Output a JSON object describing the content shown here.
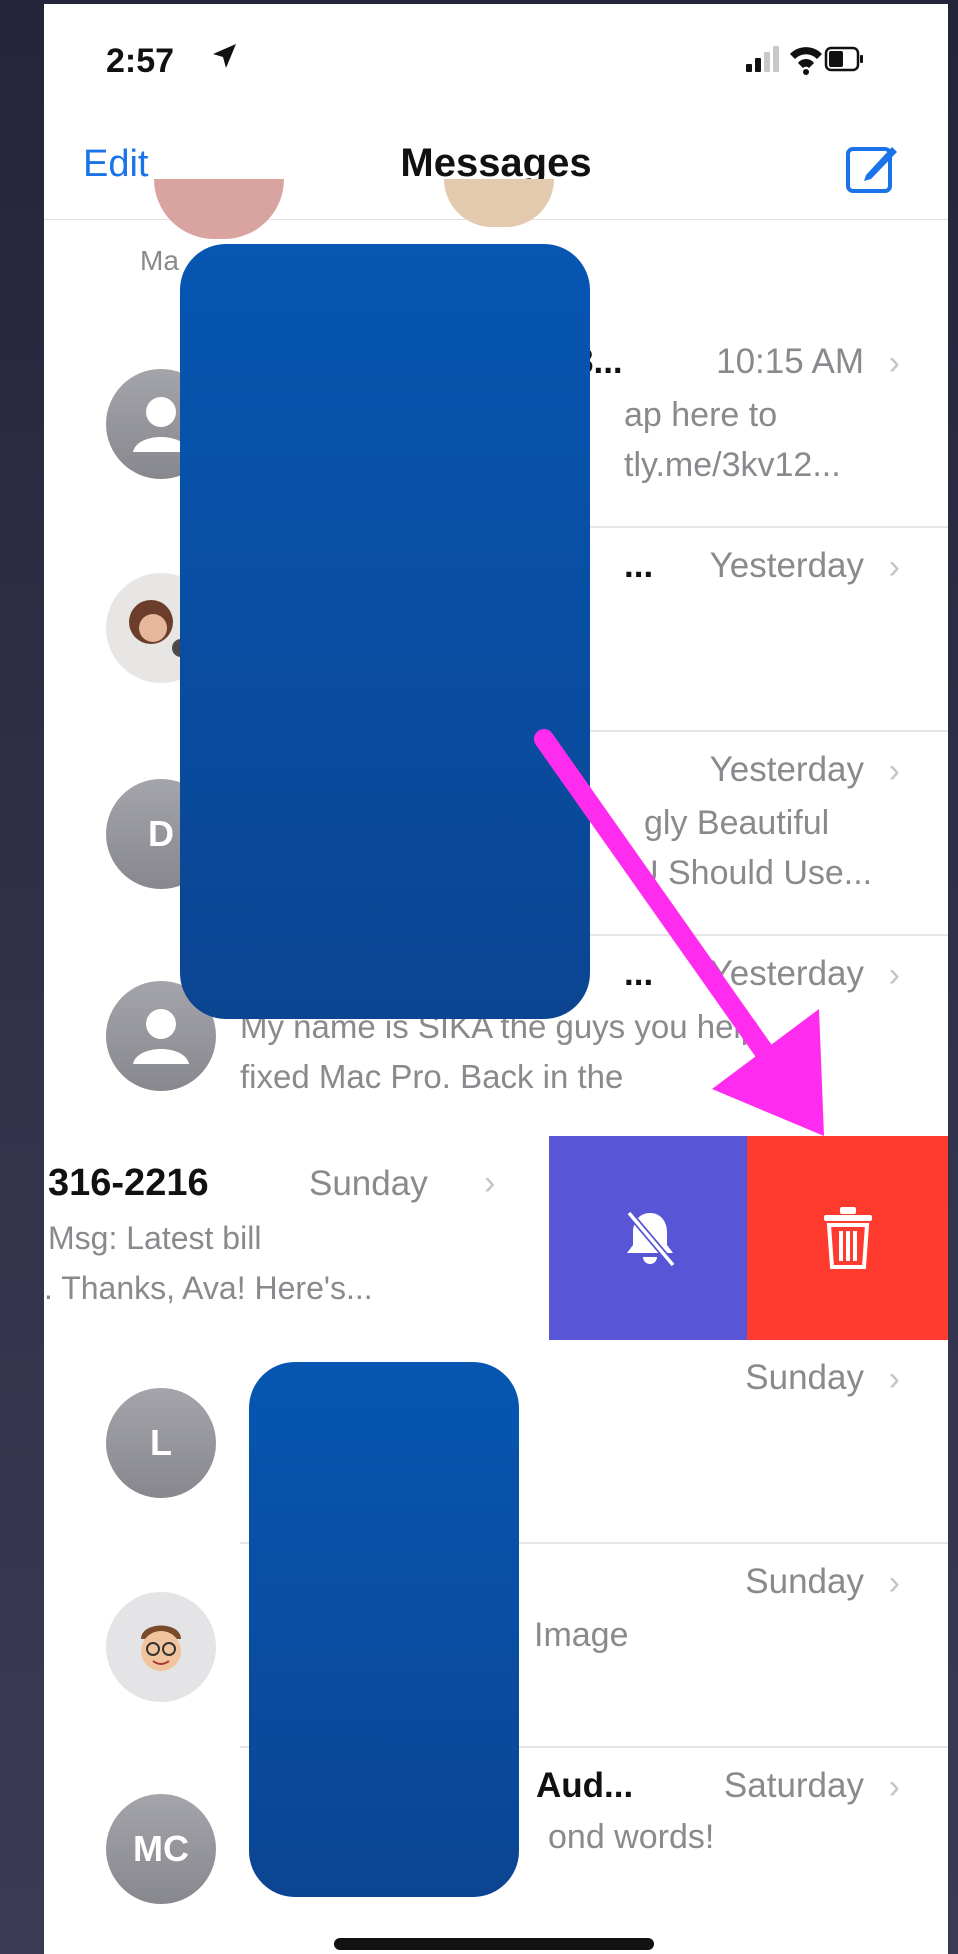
{
  "status_bar": {
    "time": "2:57"
  },
  "nav": {
    "edit_label": "Edit",
    "title": "Messages",
    "compose_icon": "compose-icon"
  },
  "top_partial": {
    "label": "Ma"
  },
  "conversations": [
    {
      "avatar": "person-icon",
      "name": "8...",
      "time": "10:15 AM",
      "preview_line1": "ap here to",
      "preview_line2": "tly.me/3kv12..."
    },
    {
      "avatar": "photo",
      "name": "...",
      "time": "Yesterday",
      "preview_line1": "",
      "preview_line2": ""
    },
    {
      "avatar_initials": "D",
      "name": "",
      "time": "Yesterday",
      "preview_line1": "gly Beautiful",
      "preview_line2": "U Should Use..."
    },
    {
      "avatar": "person-icon",
      "name": "...",
      "time": "Yesterday",
      "preview_line1": "My name is SIKA the guys you help",
      "preview_line2": "fixed Mac Pro. Back in the"
    },
    {
      "name": "316-2216",
      "time": "Sunday",
      "preview_line1": "Msg: Latest bill",
      "preview_line2": ". Thanks, Ava! Here's..."
    },
    {
      "avatar_initials": "L",
      "name": "",
      "time": "Sunday",
      "preview_line1": "",
      "preview_line2": ""
    },
    {
      "avatar": "memoji",
      "name": "",
      "time": "Sunday",
      "preview_line1": "Image",
      "preview_line2": ""
    },
    {
      "avatar_initials": "MC",
      "name": "Aud...",
      "time": "Saturday",
      "preview_line1": "ond words!",
      "preview_line2": ""
    }
  ],
  "swipe_actions": {
    "mute_icon": "bell-slash-icon",
    "delete_icon": "trash-icon"
  },
  "colors": {
    "accent": "#1a73e8",
    "mute": "#5856d6",
    "delete": "#ff3b30",
    "redaction": "#0a4fa6",
    "arrow": "#ff2cf0"
  }
}
